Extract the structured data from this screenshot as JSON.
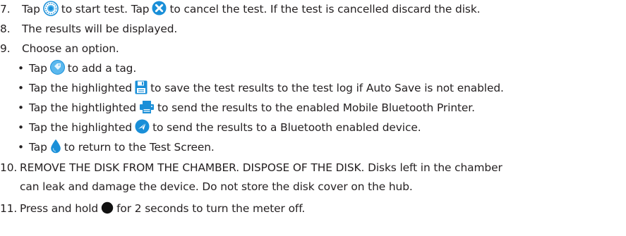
{
  "steps": [
    {
      "number": "7.",
      "parts": [
        "Tap",
        "to start test. Tap",
        "to cancel the test. If the test is cancelled discard the disk."
      ],
      "icons": [
        "start-test-icon",
        "cancel-test-icon"
      ]
    },
    {
      "number": "8.",
      "text": "The results will be displayed."
    },
    {
      "number": "9.",
      "text": "Choose an option."
    },
    {
      "number": "10.",
      "lines": [
        "REMOVE THE DISK FROM THE CHAMBER. DISPOSE OF THE DISK. Disks left in the chamber",
        "can leak and damage the device. Do not store the disk cover on the hub."
      ]
    },
    {
      "number": "11.",
      "parts": [
        "Press and hold",
        "for 2 seconds to turn the meter off."
      ],
      "icon": "power-button-icon"
    }
  ],
  "options": [
    {
      "bullet": "•",
      "before": "Tap",
      "icon": "tag-icon",
      "after": "to add a tag."
    },
    {
      "bullet": "•",
      "before": "Tap the highlighted",
      "icon": "save-icon",
      "after": "to save the test results to the test log if Auto Save is not enabled."
    },
    {
      "bullet": "•",
      "before": "Tap the hightlighted",
      "icon": "printer-icon",
      "after": "to send the results to the enabled Mobile Bluetooth Printer."
    },
    {
      "bullet": "•",
      "before": "Tap the highlighted",
      "icon": "send-bluetooth-icon",
      "after": "to send the results to a Bluetooth enabled device."
    },
    {
      "bullet": "•",
      "before": "Tap",
      "icon": "drop-icon",
      "after": "to return to the Test Screen."
    }
  ],
  "colors": {
    "text": "#231f20",
    "icon_blue": "#1a8fd8",
    "icon_light_blue": "#5bb8ee",
    "power_button": "#111111"
  }
}
